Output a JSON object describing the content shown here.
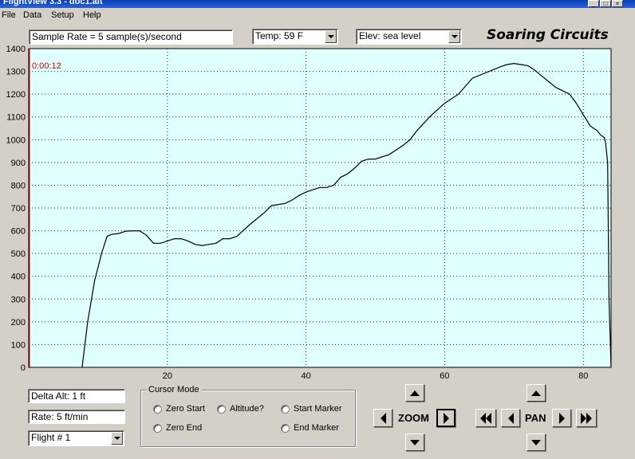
{
  "window": {
    "title": "FlightView 3.3 - doc1.alt"
  },
  "menu": [
    "File",
    "Data",
    "Setup",
    "Help"
  ],
  "header": {
    "sample_rate": "Sample Rate =  5 sample(s)/second",
    "temp": "Temp:  59 F",
    "elev": "Elev: sea level",
    "logo": "Soaring Circuits"
  },
  "chart_data": {
    "type": "line",
    "time_label": "0:00:12",
    "xlim": [
      0,
      84
    ],
    "ylim": [
      0,
      1400
    ],
    "yticks": [
      0,
      100,
      200,
      300,
      400,
      500,
      600,
      700,
      800,
      900,
      1000,
      1100,
      1200,
      1300,
      1400
    ],
    "xticks": [
      20,
      40,
      60,
      80
    ],
    "background": "#e0ffff",
    "line_color": "#000000",
    "grid": true,
    "x": [
      7.7,
      8.5,
      9.5,
      10.5,
      11.3,
      12,
      13,
      14,
      15,
      16,
      17,
      18,
      19,
      20,
      21,
      22,
      23,
      24,
      25,
      26,
      27,
      28,
      29,
      30,
      32,
      34,
      35,
      37,
      38,
      39,
      40,
      41,
      42,
      43,
      44,
      45,
      46,
      47,
      48,
      49,
      50,
      52,
      54,
      55,
      56,
      58,
      60,
      62,
      64,
      66,
      68,
      69,
      70,
      71,
      72,
      73,
      74,
      76,
      78,
      79,
      80,
      81,
      82,
      82.5,
      83,
      83.2,
      83.5,
      83.7,
      84
    ],
    "y": [
      0,
      200,
      380,
      500,
      575,
      585,
      588,
      598,
      600,
      600,
      580,
      545,
      545,
      555,
      565,
      565,
      555,
      540,
      535,
      540,
      545,
      565,
      565,
      575,
      630,
      680,
      710,
      720,
      735,
      755,
      770,
      780,
      790,
      790,
      800,
      835,
      850,
      875,
      905,
      915,
      915,
      935,
      975,
      1000,
      1040,
      1105,
      1160,
      1200,
      1270,
      1295,
      1320,
      1330,
      1335,
      1330,
      1325,
      1305,
      1280,
      1230,
      1200,
      1160,
      1110,
      1060,
      1040,
      1020,
      1010,
      990,
      900,
      300,
      0
    ]
  },
  "controls": {
    "delta_alt": "Delta Alt: 1 ft",
    "rate": "Rate: 5 ft/min",
    "flight": "Flight # 1",
    "cursor_mode_title": "Cursor Mode",
    "radios": [
      "Zero Start",
      "Altitude?",
      "Start Marker",
      "Zero End",
      "End Marker"
    ],
    "zoom_label": "ZOOM",
    "pan_label": "PAN"
  }
}
